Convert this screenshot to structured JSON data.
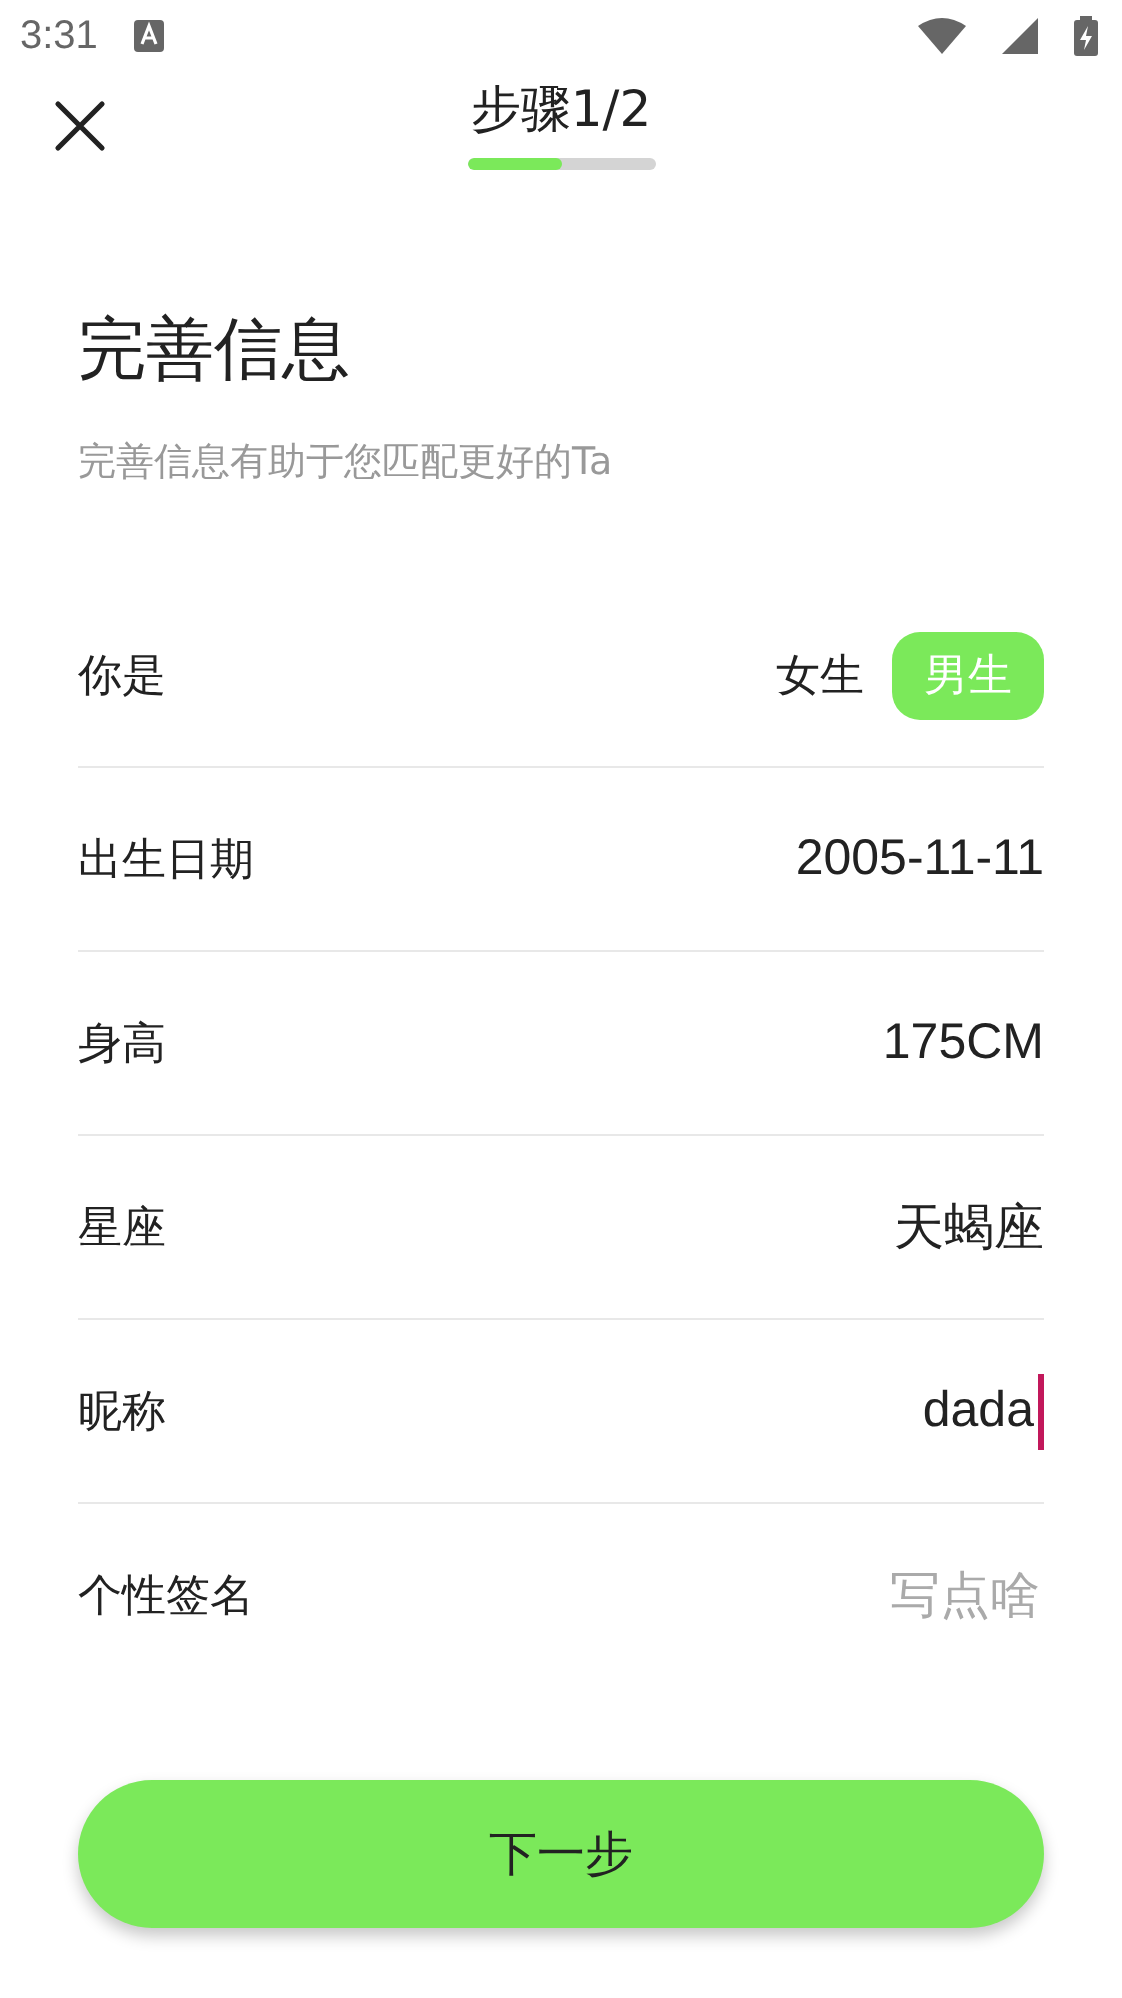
{
  "status_bar": {
    "time": "3:31"
  },
  "header": {
    "step": "步骤1/2",
    "level": 0.5
  },
  "title": "完善信息",
  "subtitle": "完善信息有助于您匹配更好的Ta",
  "rows": [
    {
      "kind": "choice",
      "label": "你是",
      "options": [
        {
          "label": "女生",
          "selected": false
        },
        {
          "label": "男生",
          "selected": true
        }
      ]
    },
    {
      "kind": "value",
      "label": "出生日期",
      "value": "2005-11-11"
    },
    {
      "kind": "value",
      "label": "身高",
      "value": "175CM"
    },
    {
      "kind": "value",
      "label": "星座",
      "value": "天蝎座"
    },
    {
      "kind": "input",
      "label": "昵称",
      "value": "dada"
    },
    {
      "kind": "input",
      "label": "个性签名",
      "placeholder": "写点啥"
    }
  ],
  "next_button": "下一步"
}
